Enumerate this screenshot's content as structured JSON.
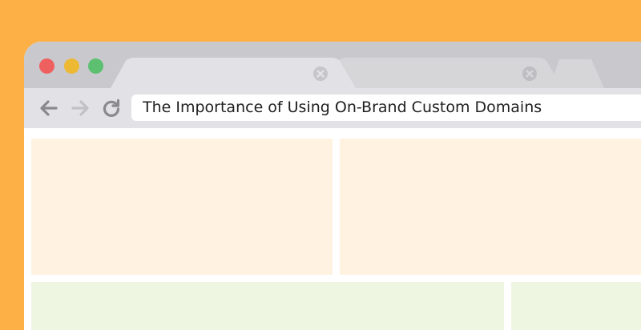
{
  "browser": {
    "address_bar": {
      "value": "The Importance of Using On-Brand Custom Domains"
    },
    "tabs": [
      {
        "state": "active",
        "icon": "close-icon"
      },
      {
        "state": "inactive",
        "icon": "close-icon"
      },
      {
        "state": "new-tab"
      }
    ],
    "window_controls": [
      "close",
      "minimize",
      "maximize"
    ],
    "toolbar_icons": [
      "back-arrow-icon",
      "forward-arrow-icon",
      "reload-icon"
    ]
  },
  "colors": {
    "background": "#FDB045",
    "tab_bar": "#C9C9CD",
    "toolbar": "#E2E2E6",
    "content_top_blocks": "#FFF2E1",
    "content_bottom_blocks": "#EEF6E1",
    "close_dot": "#EE6060",
    "minimize_dot": "#EDB932",
    "maximize_dot": "#5DC071"
  }
}
